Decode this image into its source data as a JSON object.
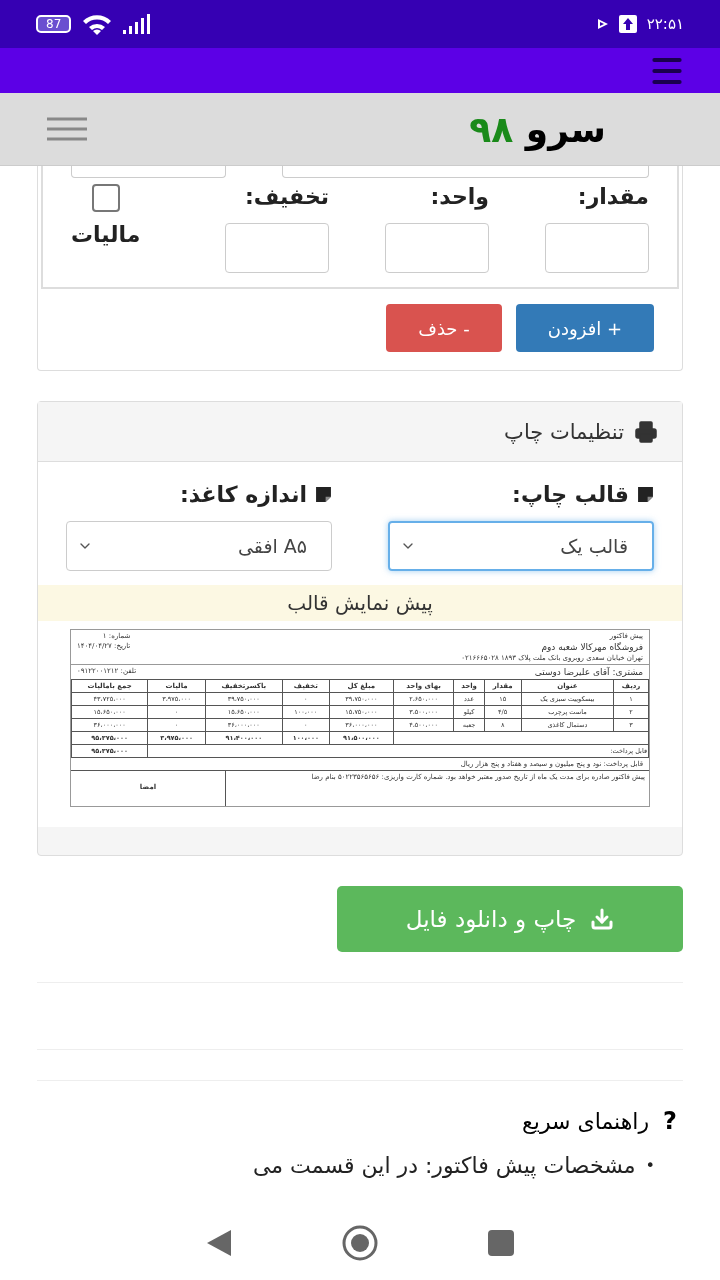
{
  "status_bar": {
    "battery": "87",
    "time": "۲۲:۵۱"
  },
  "header": {
    "logo_text": "سرو",
    "logo_number": "۹۸"
  },
  "item_form": {
    "fields": [
      {
        "label": "مقدار:"
      },
      {
        "label": "واحد:"
      },
      {
        "label": "تخفیف:"
      }
    ],
    "tax": {
      "label": "مالیات",
      "checked": false
    },
    "buttons": [
      {
        "kind": "add",
        "label": "+ افزودن"
      },
      {
        "kind": "delete",
        "label": "- حذف"
      }
    ]
  },
  "print_settings": {
    "title": "تنظیمات چاپ",
    "selects": [
      {
        "label": "قالب چاپ:",
        "value": "قالب یک",
        "focused": true
      },
      {
        "label": "اندازه کاغذ:",
        "value": "A۵ افقی",
        "focused": false
      }
    ],
    "preview_title": "پیش نمایش قالب",
    "invoice": {
      "doc_title": "پیش فاکتور",
      "store": "فروشگاه مهرکالا شعبه دوم",
      "address": "تهران خیابان سعدی روبروی بانک ملت پلاک ۱۸۹۳ ۰۲۱۶۶۶۵۰۲۸",
      "number": "شماره: ۱",
      "date": "تاریخ: ۱۴۰۴/۰۴/۲۷",
      "customer": "مشتری: آقای علیرضا دوستی",
      "phone": "تلفن: ۰۹۱۲۲۰۰۱۲۱۲",
      "columns": [
        "ردیف",
        "عنوان",
        "مقدار",
        "واحد",
        "بهای واحد",
        "مبلغ کل",
        "تخفیف",
        "باکسرتخفیف",
        "مالیات",
        "جمع بامالیات"
      ],
      "rows": [
        [
          "۱",
          "بیسکوییت سبزی یک",
          "۱۵",
          "عدد",
          "۲،۶۵۰،۰۰۰",
          "۳۹،۷۵۰،۰۰۰",
          "۰",
          "۳۹،۷۵۰،۰۰۰",
          "۳،۹۷۵،۰۰۰",
          "۴۳،۷۲۵،۰۰۰"
        ],
        [
          "۲",
          "ماست پرچرب",
          "۴/۵",
          "کیلو",
          "۳،۵۰۰،۰۰۰",
          "۱۵،۷۵۰،۰۰۰",
          "۱۰۰،۰۰۰",
          "۱۵،۶۵۰،۰۰۰",
          "۰",
          "۱۵،۶۵۰،۰۰۰"
        ],
        [
          "۳",
          "دستمال کاغذی",
          "۸",
          "جعبه",
          "۴،۵۰۰،۰۰۰",
          "۳۶،۰۰۰،۰۰۰",
          "۰",
          "۳۶،۰۰۰،۰۰۰",
          "۰",
          "۳۶،۰۰۰،۰۰۰"
        ]
      ],
      "totals": [
        "۹۱،۵۰۰،۰۰۰",
        "۱۰۰،۰۰۰",
        "۹۱،۴۰۰،۰۰۰",
        "۳،۹۷۵،۰۰۰",
        "۹۵،۳۷۵،۰۰۰"
      ],
      "payable_label": "قابل پرداخت:",
      "payable_total": "۹۵،۳۷۵،۰۰۰",
      "amount_words": "قابل پرداخت: نود و پنج میلیون و سیصد و هفتاد و پنج هزار ریال",
      "note": "پیش فاکتور صادره برای مدت یک ماه از تاریخ صدور معتبر خواهد بود. شماره کارت واریزی: ۵۰۲۲۳۵۶۵۶۵۶ بنام رضا",
      "signature": "امضا"
    }
  },
  "download_button": {
    "label": "چاپ و دانلود فایل"
  },
  "help": {
    "icon": "?",
    "title": "راهنمای سریع",
    "items": [
      {
        "bullet": "•",
        "text": "مشخصات پیش فاکتور: در این قسمت می"
      }
    ]
  }
}
